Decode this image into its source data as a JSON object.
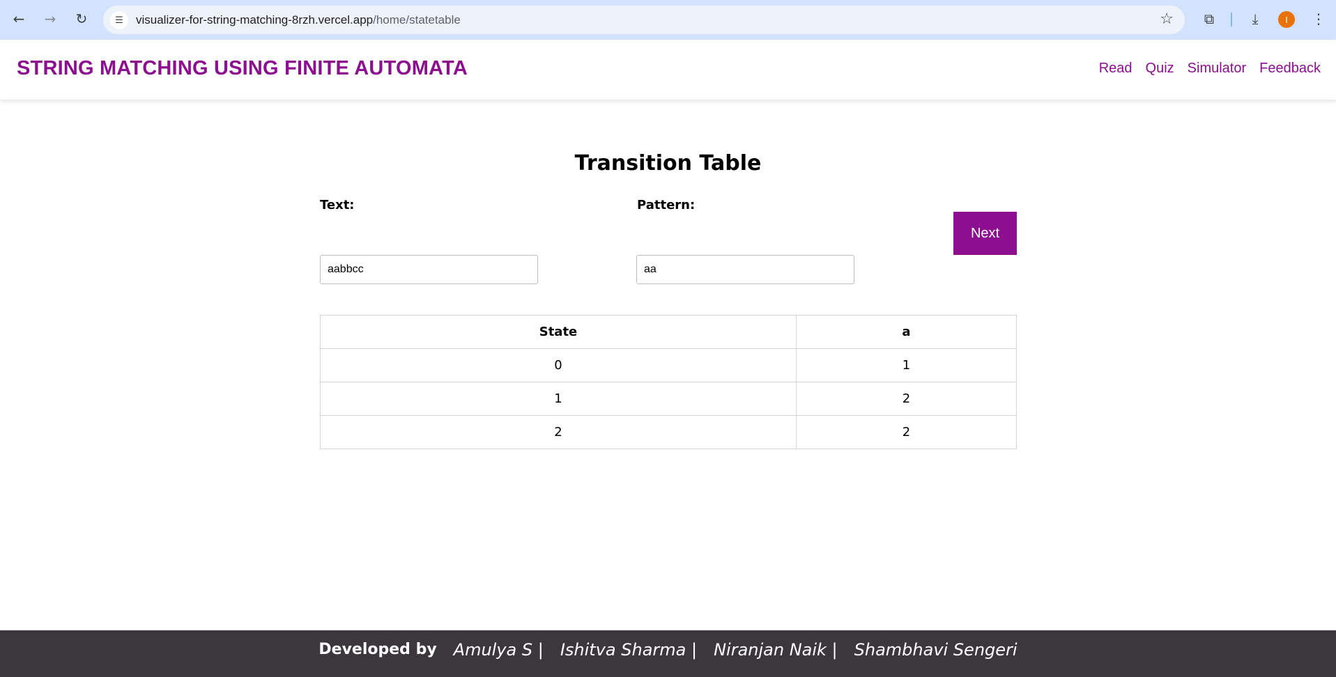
{
  "browser": {
    "url_host": "visualizer-for-string-matching-8rzh.vercel.app",
    "url_path": "/home/statetable",
    "avatar_letter": "I"
  },
  "header": {
    "title": "STRING MATCHING USING FINITE AUTOMATA",
    "nav": [
      "Read",
      "Quiz",
      "Simulator",
      "Feedback"
    ]
  },
  "main": {
    "heading": "Transition Table",
    "text_label": "Text:",
    "text_value": "aabbcc",
    "pattern_label": "Pattern:",
    "pattern_value": "aa",
    "next_label": "Next",
    "table": {
      "headers": [
        "State",
        "a"
      ],
      "rows": [
        [
          "0",
          "1"
        ],
        [
          "1",
          "2"
        ],
        [
          "2",
          "2"
        ]
      ]
    }
  },
  "footer": {
    "developed_by": "Developed by",
    "names": [
      "Amulya S |",
      "Ishitva Sharma |",
      "Niranjan Naik |",
      "Shambhavi Sengeri"
    ]
  },
  "colors": {
    "brand": "#8b0f8f",
    "footer_bg": "#3b373d",
    "chrome_bg": "#d3e3fd"
  }
}
